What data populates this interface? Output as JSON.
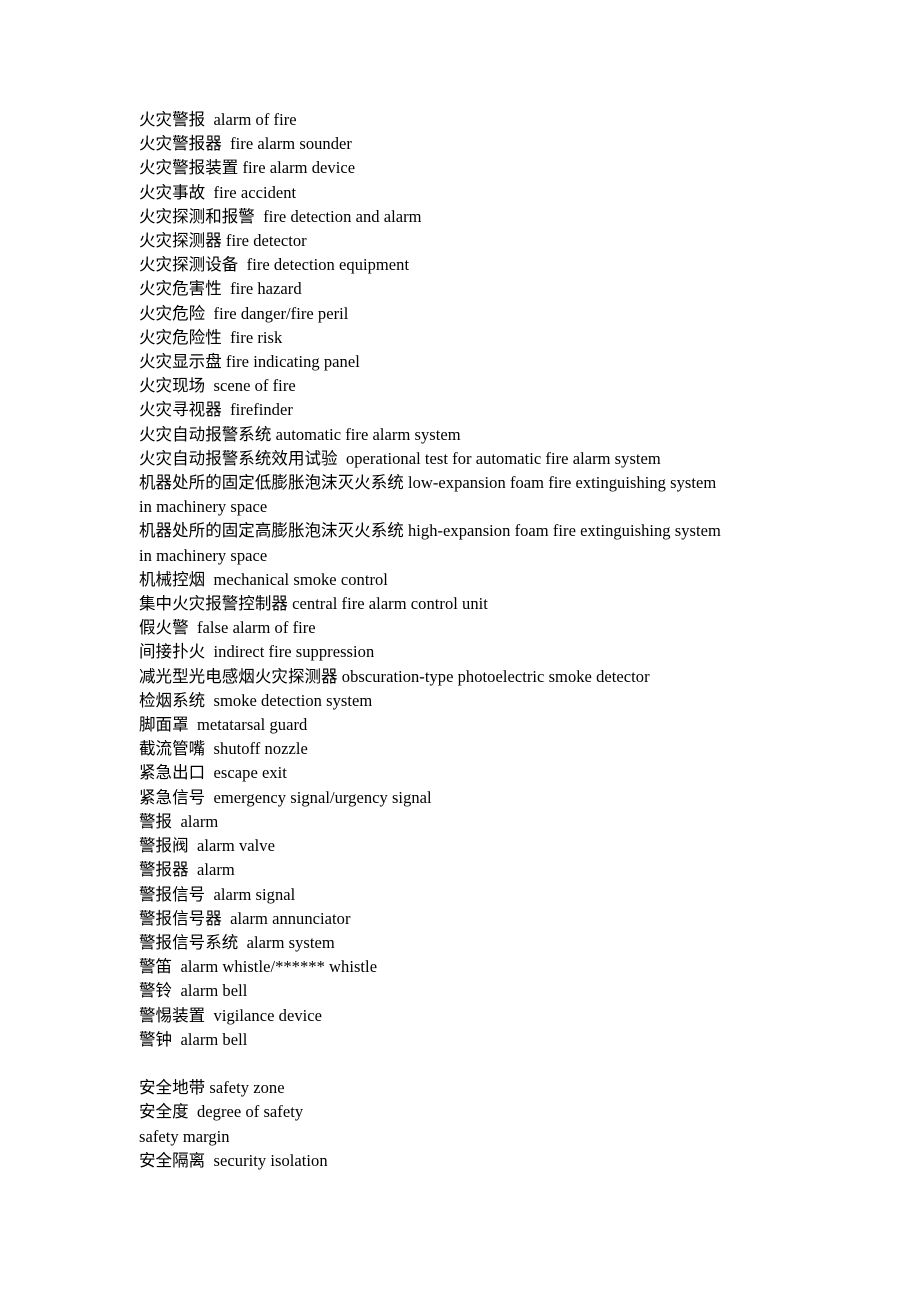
{
  "document": {
    "title": "Fire Safety Bilingual Glossary",
    "background_color": "#ffffff",
    "text_color": "#000000",
    "sections": [
      {
        "name": "fire-alarm-terms",
        "entries": [
          "火灾警报  alarm of fire",
          "火灾警报器  fire alarm sounder",
          "火灾警报装置 fire alarm device",
          "火灾事故  fire accident",
          "火灾探测和报警  fire detection and alarm",
          "火灾探测器 fire detector",
          "火灾探测设备  fire detection equipment",
          "火灾危害性  fire hazard",
          "火灾危险  fire danger/fire peril",
          "火灾危险性  fire risk",
          "火灾显示盘 fire indicating panel",
          "火灾现场  scene of fire",
          "火灾寻视器  firefinder",
          "火灾自动报警系统 automatic fire alarm system",
          "火灾自动报警系统效用试验  operational test for automatic fire alarm system",
          "机器处所的固定低膨胀泡沫灭火系统 low-expansion foam fire extinguishing system in machinery space",
          "机器处所的固定高膨胀泡沫灭火系统 high-expansion foam fire extinguishing system in machinery space",
          "机械控烟  mechanical smoke control",
          "集中火灾报警控制器 central fire alarm control unit",
          "假火警  false alarm of fire",
          "间接扑火  indirect fire suppression",
          "减光型光电感烟火灾探测器 obscuration-type photoelectric smoke detector",
          "检烟系统  smoke detection system",
          "脚面罩  metatarsal guard",
          "截流管嘴  shutoff nozzle",
          "紧急出口  escape exit",
          "紧急信号  emergency signal/urgency signal",
          "警报  alarm",
          "警报阀  alarm valve",
          "警报器  alarm",
          "警报信号  alarm signal",
          "警报信号器  alarm annunciator",
          "警报信号系统  alarm system",
          "警笛  alarm whistle/****** whistle",
          "警铃  alarm bell",
          "警惕装置  vigilance device",
          "警钟  alarm bell"
        ]
      },
      {
        "name": "safety-terms",
        "entries": [
          "安全地带 safety zone",
          "安全度  degree of safety",
          "safety margin",
          "安全隔离  security isolation"
        ]
      }
    ]
  }
}
